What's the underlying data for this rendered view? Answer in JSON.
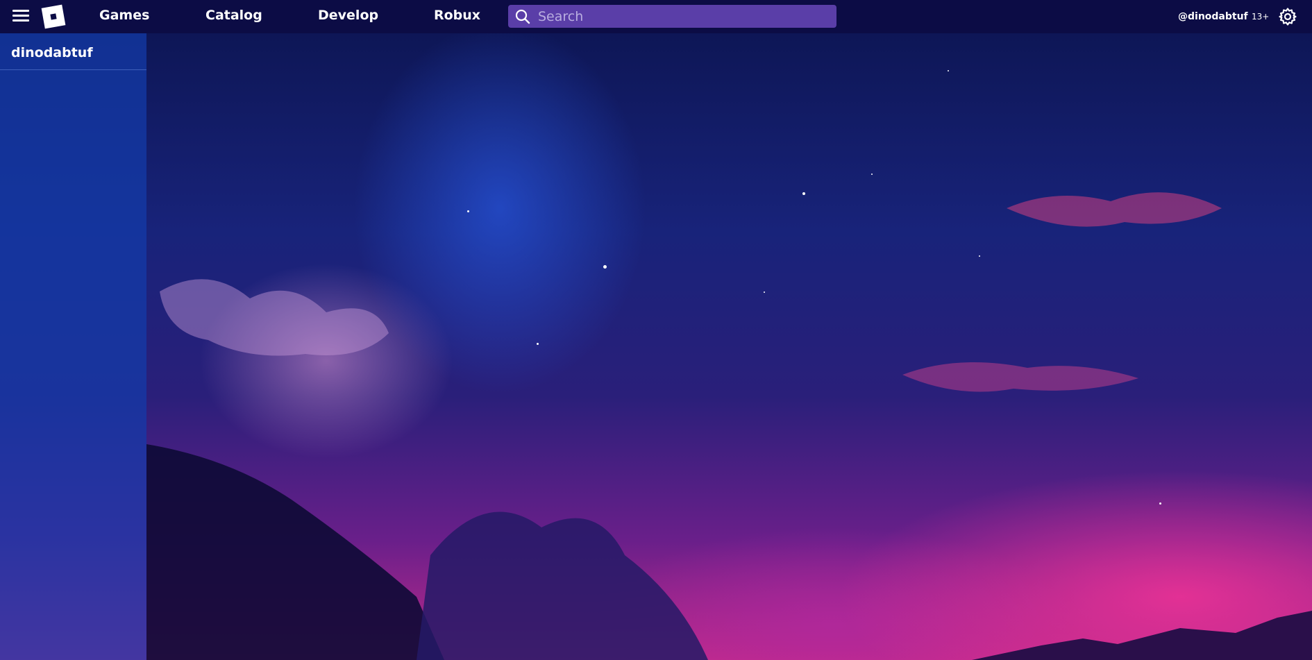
{
  "topbar": {
    "menu_icon": "hamburger-menu-icon",
    "logo_icon": "roblox-logo-icon",
    "nav": [
      {
        "label": "Games"
      },
      {
        "label": "Catalog"
      },
      {
        "label": "Develop"
      },
      {
        "label": "Robux"
      }
    ],
    "search": {
      "placeholder": "Search",
      "value": "",
      "icon": "search-icon"
    },
    "username": "@dinodabtuf",
    "age_badge": "13+",
    "settings_icon": "gear-icon"
  },
  "sidebar": {
    "username": "dinodabtuf"
  },
  "colors": {
    "topbar_bg": "#0c0c45",
    "search_bg": "#5a3ea8",
    "sidebar_bg": "#143caa"
  }
}
